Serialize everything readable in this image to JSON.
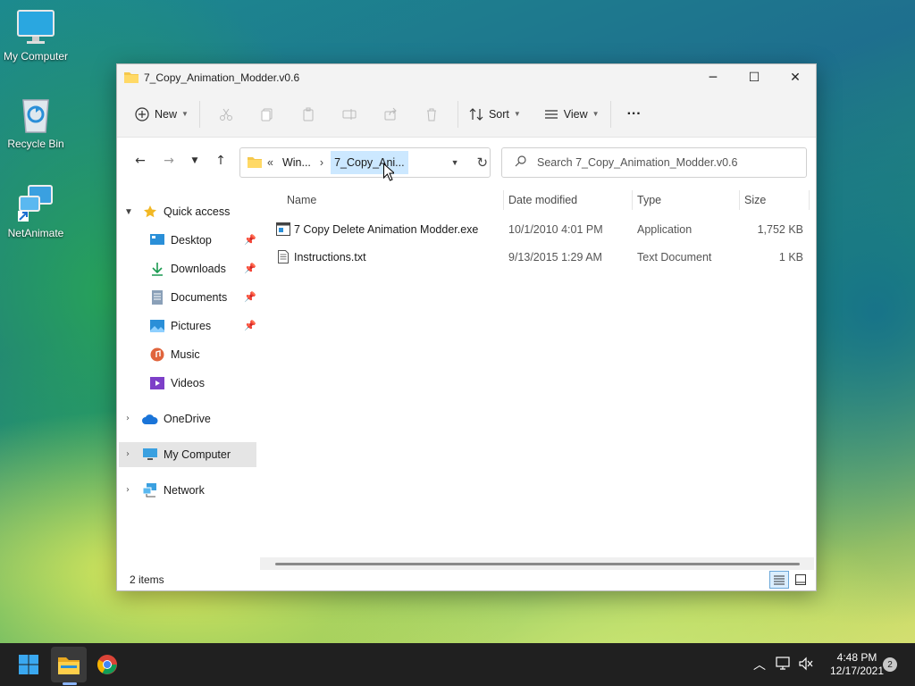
{
  "desktop": {
    "icons": [
      {
        "label": "My Computer"
      },
      {
        "label": "Recycle Bin"
      },
      {
        "label": "NetAnimate"
      }
    ]
  },
  "window": {
    "title": "7_Copy_Animation_Modder.v0.6",
    "controls": {
      "minimize": "─",
      "maximize": "☐",
      "close": "✕"
    }
  },
  "toolbar": {
    "new_label": "New",
    "sort_label": "Sort",
    "view_label": "View",
    "more_label": "···"
  },
  "address": {
    "overflow": "«",
    "crumbs": [
      "Win...",
      "7_Copy_Ani..."
    ],
    "separator": "›"
  },
  "search": {
    "placeholder": "Search 7_Copy_Animation_Modder.v0.6"
  },
  "nav": {
    "quick_access": "Quick access",
    "items": [
      {
        "label": "Desktop",
        "icon": "desktop-icon",
        "pinned": true
      },
      {
        "label": "Downloads",
        "icon": "downloads-icon",
        "pinned": true
      },
      {
        "label": "Documents",
        "icon": "documents-icon",
        "pinned": true
      },
      {
        "label": "Pictures",
        "icon": "pictures-icon",
        "pinned": true
      },
      {
        "label": "Music",
        "icon": "music-icon",
        "pinned": false
      },
      {
        "label": "Videos",
        "icon": "videos-icon",
        "pinned": false
      }
    ],
    "onedrive": "OneDrive",
    "my_computer": "My Computer",
    "network": "Network"
  },
  "columns": {
    "name": "Name",
    "date": "Date modified",
    "type": "Type",
    "size": "Size"
  },
  "files": [
    {
      "name": "7 Copy Delete Animation Modder.exe",
      "date": "10/1/2010 4:01 PM",
      "type": "Application",
      "size": "1,752 KB"
    },
    {
      "name": "Instructions.txt",
      "date": "9/13/2015 1:29 AM",
      "type": "Text Document",
      "size": "1 KB"
    }
  ],
  "status": {
    "count": "2 items"
  },
  "taskbar": {
    "time": "4:48 PM",
    "date": "12/17/2021",
    "notifications": "2"
  },
  "colors": {
    "accent": "#0067c0",
    "folder": "#f5c84c",
    "selection": "#cce8ff"
  }
}
